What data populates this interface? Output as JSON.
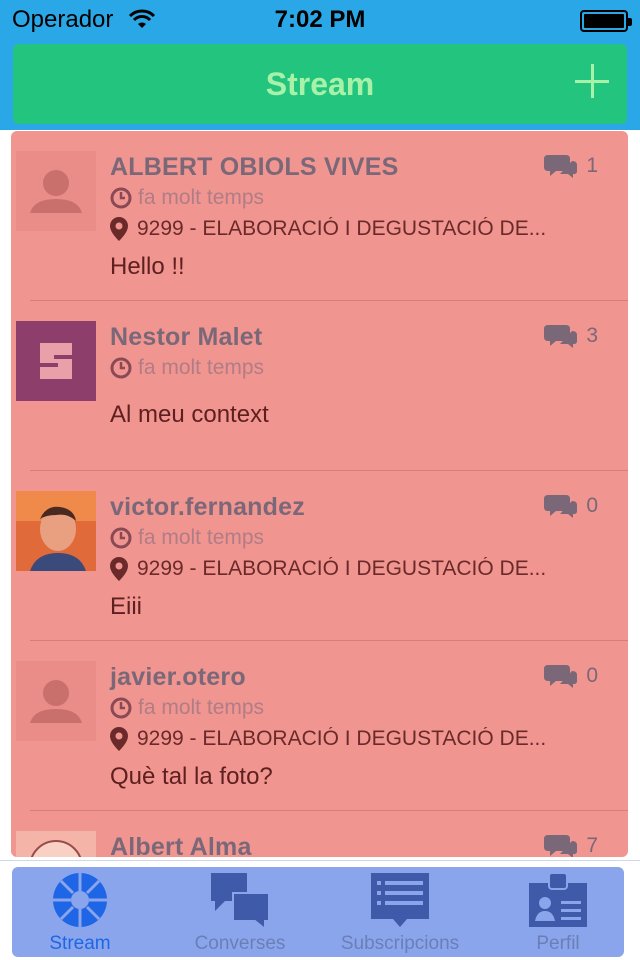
{
  "status_bar": {
    "carrier": "Operador",
    "time": "7:02 PM"
  },
  "header": {
    "title": "Stream"
  },
  "posts": [
    {
      "author": "ALBERT OBIOLS VIVES",
      "comment_count": "1",
      "time": "fa molt temps",
      "location": "9299 - ELABORACIÓ I DEGUSTACIÓ DE...",
      "message": "Hello !!",
      "avatar": "default-avatar"
    },
    {
      "author": "Nestor Malet",
      "comment_count": "3",
      "time": "fa molt temps",
      "location": "",
      "message": "Al meu context",
      "avatar": "s-logo-avatar"
    },
    {
      "author": "victor.fernandez",
      "comment_count": "0",
      "time": "fa molt temps",
      "location": "9299 - ELABORACIÓ I DEGUSTACIÓ DE...",
      "message": "Eiii",
      "avatar": "photo-avatar"
    },
    {
      "author": "javier.otero",
      "comment_count": "0",
      "time": "fa molt temps",
      "location": "9299 - ELABORACIÓ I DEGUSTACIÓ DE...",
      "message": "Què tal la foto?",
      "avatar": "default-avatar"
    },
    {
      "author": "Albert Alma",
      "comment_count": "7",
      "time": "",
      "location": "",
      "message": "",
      "avatar": "cartoon-avatar"
    }
  ],
  "tab_bar": {
    "tabs": [
      {
        "label": "Stream",
        "icon": "stream-wheel-icon",
        "active": true
      },
      {
        "label": "Converses",
        "icon": "chat-bubbles-icon",
        "active": false
      },
      {
        "label": "Subscripcions",
        "icon": "subscriptions-list-icon",
        "active": false
      },
      {
        "label": "Perfil",
        "icon": "id-card-icon",
        "active": false
      }
    ]
  },
  "colors": {
    "status_bar": "#2aa7e6",
    "nav_bar": "#22c47e",
    "nav_title": "#a7f2a8",
    "feed_background": "#f19590",
    "tab_bar": "#8aa5ec",
    "tab_active": "#1f66e6"
  }
}
